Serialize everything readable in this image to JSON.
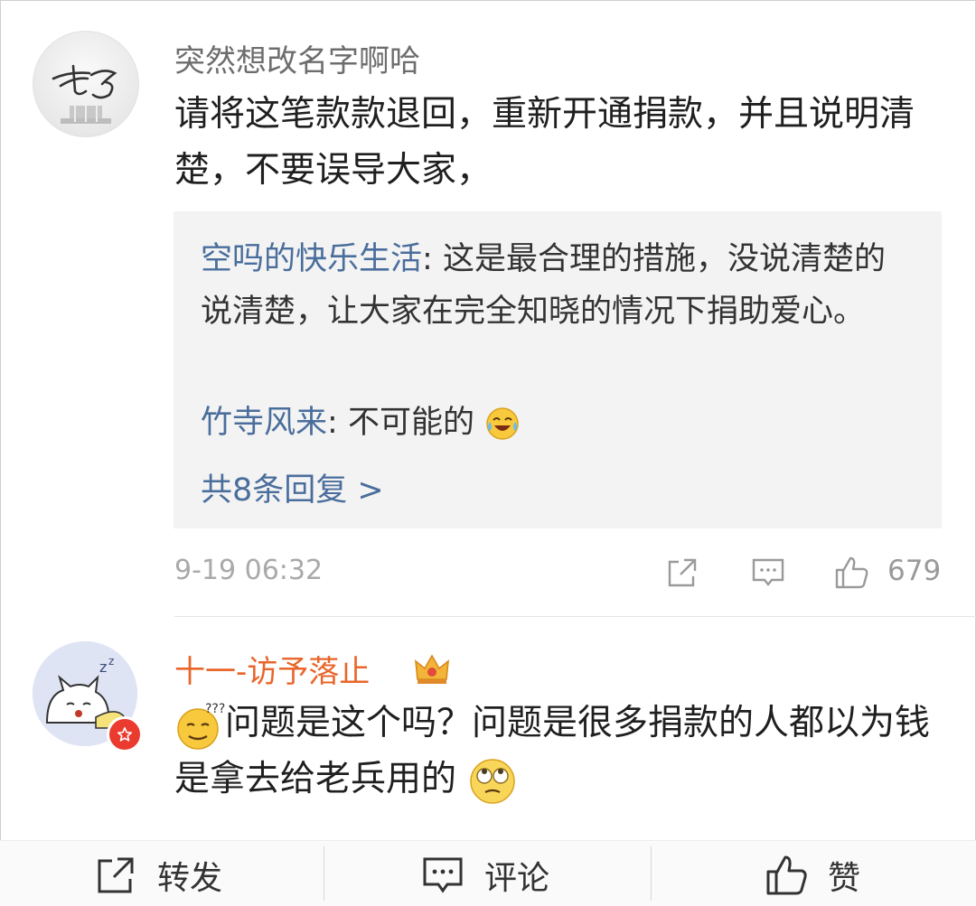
{
  "comment1": {
    "username": "突然想改名字啊哈",
    "text": "请将这笔款款退回，重新开通捐款，并且说明清楚，不要误导大家，",
    "replies": [
      {
        "name": "空吗的快乐生活",
        "sep": ": ",
        "text": "这是最合理的措施，没说清楚的说清楚，让大家在完全知晓的情况下捐助爱心。"
      },
      {
        "name": "竹寺风来",
        "sep": ": ",
        "text": "不可能的",
        "emoji": "laughing-crying-emoji"
      }
    ],
    "more_replies": "共8条回复 >",
    "timestamp": "9-19 06:32",
    "like_count": "679"
  },
  "comment2": {
    "username": "十一-访予落止",
    "text_part1": "问题是这个吗？问题是很多捐款的人都以为钱是拿去给老兵用的",
    "leading_emoji": "confused-emoji",
    "trailing_emoji": "eye-roll-emoji",
    "badge_icon": "crown-icon"
  },
  "bottom_bar": {
    "repost_label": "转发",
    "comment_label": "评论",
    "like_label": "赞"
  },
  "colors": {
    "link_blue": "#4a6e9c",
    "vip_orange": "#e8662a",
    "badge_red": "#ea3b2e"
  }
}
